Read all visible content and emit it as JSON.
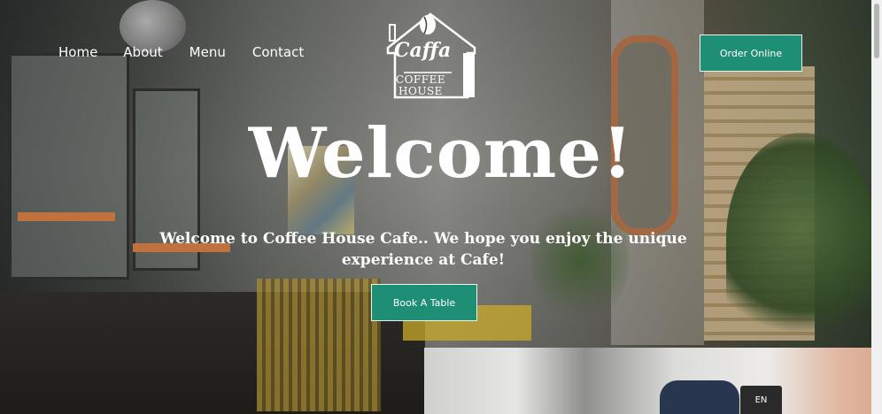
{
  "nav": {
    "items": [
      "Home",
      "About",
      "Menu",
      "Contact"
    ]
  },
  "logo": {
    "line1": "Caffa",
    "line2": "COFFEE",
    "line3": "HOUSE"
  },
  "header": {
    "order_label": "Order Online"
  },
  "hero": {
    "title": "Welcome!",
    "tagline": "Welcome to Coffee House Cafe.. We hope you enjoy the unique experience at Cafe!",
    "book_label": "Book A Table"
  },
  "language": {
    "current": "EN"
  },
  "colors": {
    "accent": "#1e8f75",
    "text": "#ffffff"
  }
}
